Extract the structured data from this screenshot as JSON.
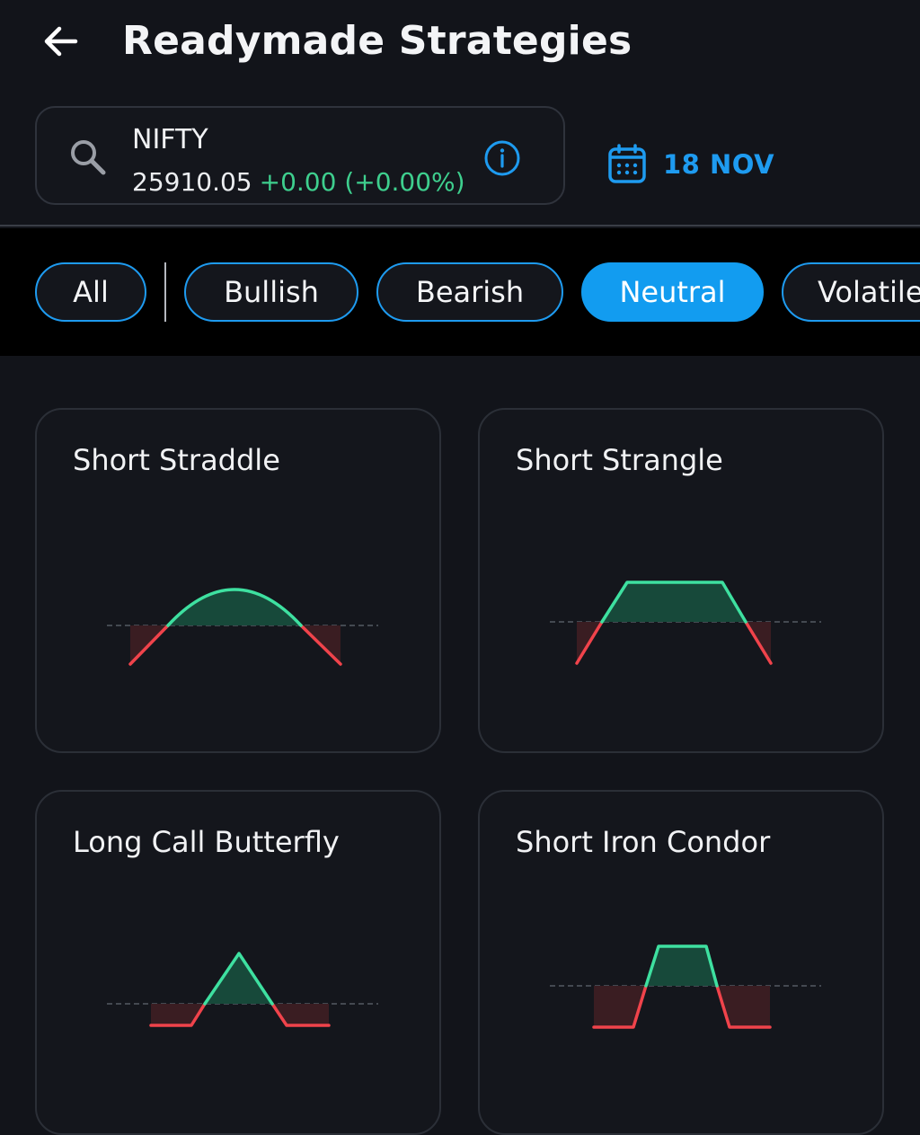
{
  "header": {
    "title": "Readymade Strategies"
  },
  "search": {
    "symbol": "NIFTY",
    "price": "25910.05",
    "change": "+0.00 (+0.00%)"
  },
  "expiry": {
    "date": "18 NOV"
  },
  "filters": [
    {
      "label": "All",
      "active": false
    },
    {
      "label": "Bullish",
      "active": false
    },
    {
      "label": "Bearish",
      "active": false
    },
    {
      "label": "Neutral",
      "active": true
    },
    {
      "label": "Volatile",
      "active": false
    }
  ],
  "strategies": [
    {
      "name": "Short Straddle",
      "payoff_shape": "peak-curve"
    },
    {
      "name": "Short Strangle",
      "payoff_shape": "plateau"
    },
    {
      "name": "Long Call Butterfly",
      "payoff_shape": "triangle-peak"
    },
    {
      "name": "Short Iron Condor",
      "payoff_shape": "box-plateau"
    }
  ],
  "colors": {
    "background": "#12141a",
    "accent": "#129cf0",
    "profit_line": "#3ee0a0",
    "profit_fill": "#17493a",
    "loss_line": "#f0434b",
    "loss_fill": "#3a1d22",
    "positive_change": "#3ecf8e"
  },
  "icons": {
    "back": "arrow-left-icon",
    "search": "search-icon",
    "info": "info-icon",
    "calendar": "calendar-icon"
  }
}
